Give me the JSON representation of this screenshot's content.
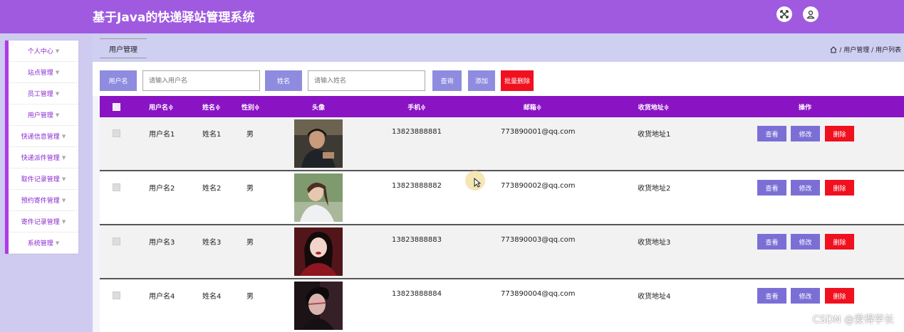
{
  "header": {
    "title": "基于Java的快递驿站管理系统",
    "icons": [
      "fullscreen-icon",
      "user-icon"
    ]
  },
  "sidebar": {
    "items": [
      {
        "label": "个人中心"
      },
      {
        "label": "站点管理"
      },
      {
        "label": "员工管理"
      },
      {
        "label": "用户管理"
      },
      {
        "label": "快递信息管理"
      },
      {
        "label": "快递派件管理"
      },
      {
        "label": "取件记录管理"
      },
      {
        "label": "预约寄件管理"
      },
      {
        "label": "寄件记录管理"
      },
      {
        "label": "系统管理"
      }
    ]
  },
  "tab": {
    "label": "用户管理"
  },
  "breadcrumb": {
    "text": "/ 用户管理 / 用户列表"
  },
  "search": {
    "username_label": "用户名",
    "username_placeholder": "请输入用户名",
    "name_label": "姓名",
    "name_placeholder": "请输入姓名",
    "query_label": "查询",
    "add_label": "添加",
    "batch_delete_label": "批量删除"
  },
  "table": {
    "headers": {
      "username": "用户名≑",
      "name": "姓名≑",
      "gender": "性别≑",
      "avatar": "头像",
      "phone": "手机≑",
      "email": "邮箱≑",
      "address": "收货地址≑",
      "actions": "操作"
    },
    "rows": [
      {
        "username": "用户名1",
        "name": "姓名1",
        "gender": "男",
        "phone": "13823888881",
        "email": "773890001@qq.com",
        "address": "收货地址1"
      },
      {
        "username": "用户名2",
        "name": "姓名2",
        "gender": "男",
        "phone": "13823888882",
        "email": "773890002@qq.com",
        "address": "收货地址2"
      },
      {
        "username": "用户名3",
        "name": "姓名3",
        "gender": "男",
        "phone": "13823888883",
        "email": "773890003@qq.com",
        "address": "收货地址3"
      },
      {
        "username": "用户名4",
        "name": "姓名4",
        "gender": "男",
        "phone": "13823888884",
        "email": "773890004@qq.com",
        "address": "收货地址4"
      }
    ],
    "actions": {
      "view": "查看",
      "edit": "修改",
      "delete": "删除"
    }
  },
  "watermark": "CSDN @爱得学长",
  "colors": {
    "header": "#a05ae0",
    "table_header": "#8a13c4",
    "action_button": "#7b6fd6",
    "danger": "#f0101e"
  }
}
